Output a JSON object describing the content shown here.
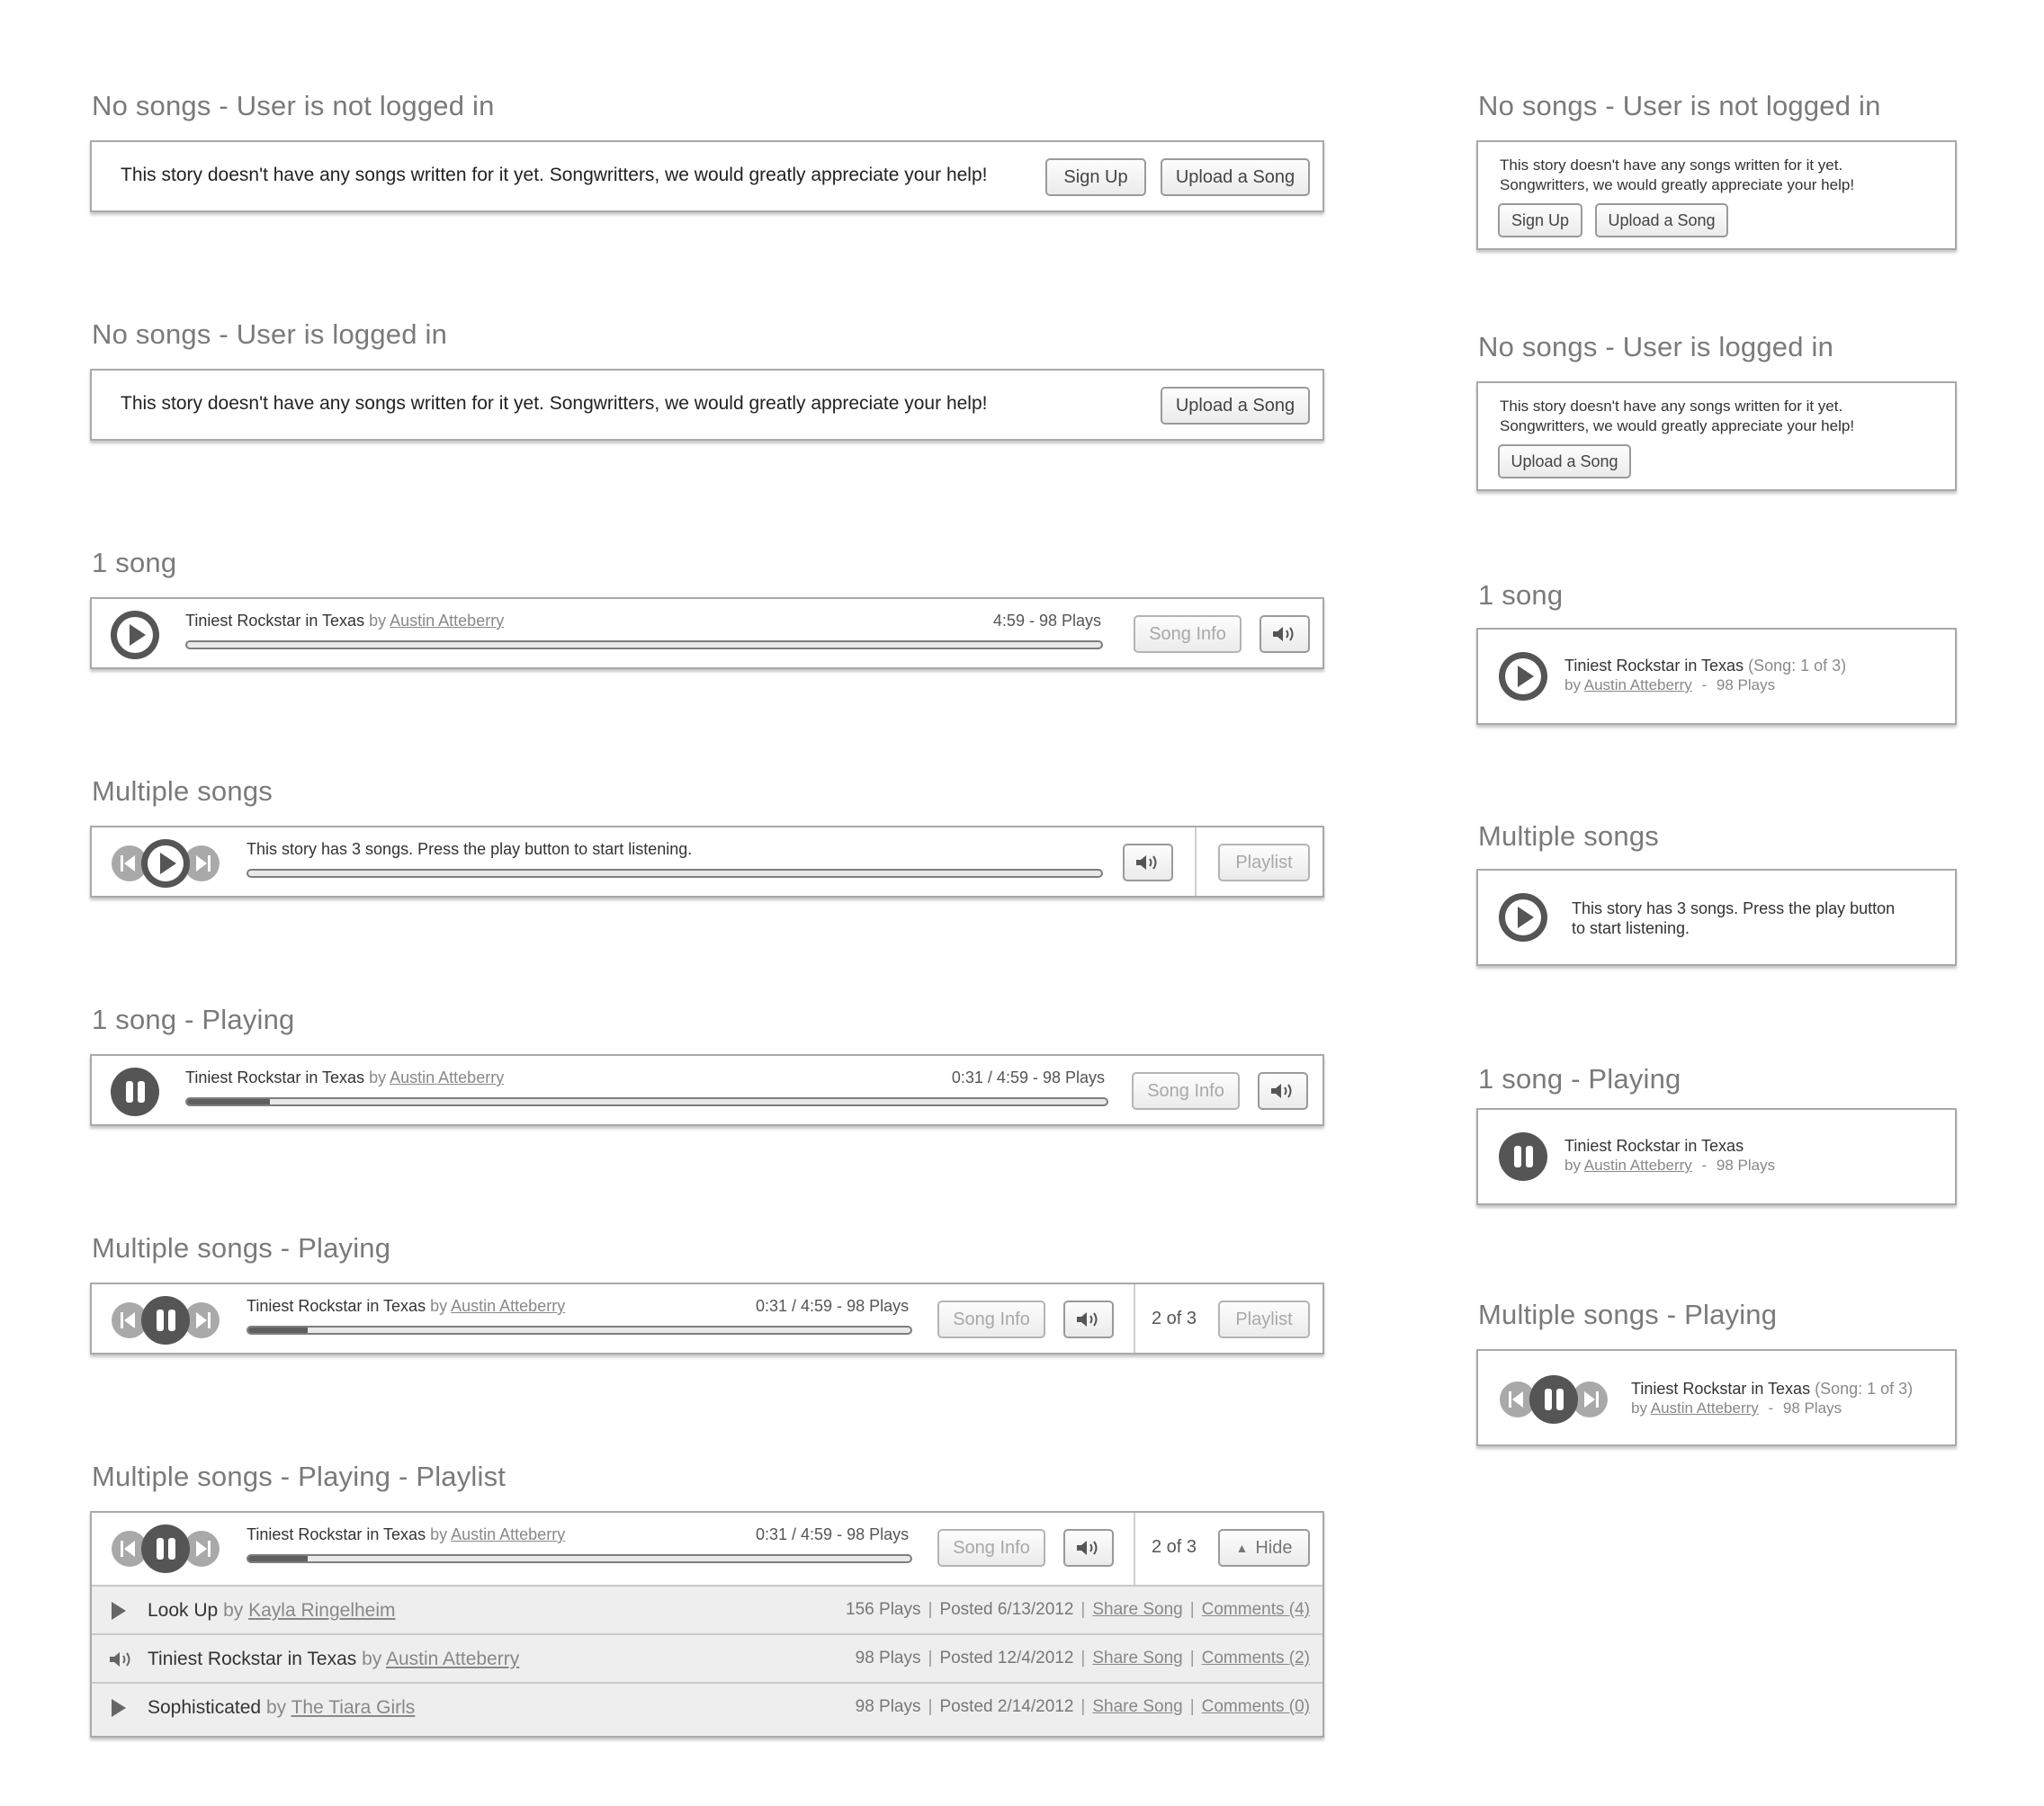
{
  "sections": {
    "no_songs_logged_out": {
      "title": "No songs - User is not logged in"
    },
    "no_songs_logged_in": {
      "title": "No songs - User is logged in"
    },
    "one_song": {
      "title": "1 song"
    },
    "multiple_songs": {
      "title": "Multiple songs"
    },
    "one_song_playing": {
      "title": "1 song - Playing"
    },
    "multiple_playing": {
      "title": "Multiple songs - Playing"
    },
    "multiple_playing_playlist": {
      "title": "Multiple songs - Playing - Playlist"
    }
  },
  "messages": {
    "no_songs": "This story doesn't have any songs written for it yet. Songwritters, we would greatly appreciate your help!",
    "no_songs_line1": "This story doesn't have any songs written for it yet.",
    "no_songs_line2": "Songwritters, we would greatly appreciate your help!",
    "multiple": "This story has 3 songs. Press the play button to start listening.",
    "multiple_line1": "This story has 3 songs. Press the play button",
    "multiple_line2": "to start listening."
  },
  "buttons": {
    "sign_up": "Sign Up",
    "upload": "Upload a Song",
    "song_info": "Song Info",
    "playlist": "Playlist",
    "hide": "Hide"
  },
  "track": {
    "title": "Tiniest Rockstar in Texas",
    "by": "by",
    "artist": "Austin Atteberry",
    "duration_plays": "4:59 - 98 Plays",
    "progress_plays": "0:31 / 4:59 - 98 Plays",
    "plays": "98 Plays",
    "song_of": "(Song: 1 of 3)",
    "dash": "-",
    "position": "2 of 3",
    "progress_fraction": 0.09
  },
  "playlist": [
    {
      "title": "Look Up",
      "by": "by",
      "artist": "Kayla Ringelheim",
      "plays": "156 Plays",
      "posted": "Posted 6/13/2012",
      "share": "Share Song",
      "comments": "Comments (4)",
      "state": "play-icon"
    },
    {
      "title": "Tiniest Rockstar in Texas",
      "by": "by",
      "artist": "Austin Atteberry",
      "plays": "98 Plays",
      "posted": "Posted 12/4/2012",
      "share": "Share Song",
      "comments": "Comments (2)",
      "state": "speaker-icon"
    },
    {
      "title": "Sophisticated",
      "by": "by",
      "artist": "The Tiara Girls",
      "plays": "98 Plays",
      "posted": "Posted 2/14/2012",
      "share": "Share Song",
      "comments": "Comments (0)",
      "state": "play-icon"
    }
  ],
  "colors": {
    "accent": "#555555",
    "progress": "#5f5f5f",
    "border": "#a9a9a9",
    "row_bg": "#eeeeee"
  }
}
